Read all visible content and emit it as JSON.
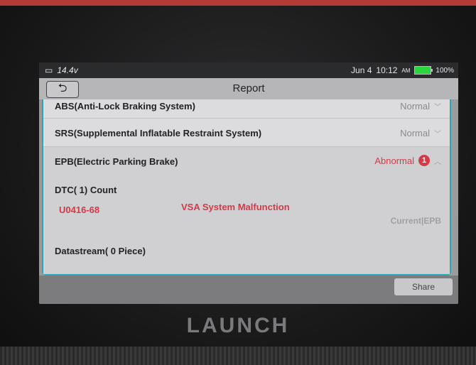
{
  "status_bar": {
    "voltage": "14.4v",
    "date": "Jun 4",
    "time": "10:12",
    "ampm": "AM",
    "battery": "100%"
  },
  "app_bar": {
    "title": "Report",
    "back_icon": "back-arrow-icon"
  },
  "systems": [
    {
      "name": "ABS(Anti-Lock Braking System)",
      "status": "Normal"
    },
    {
      "name": "SRS(Supplemental Inflatable Restraint System)",
      "status": "Normal"
    },
    {
      "name": "EPB(Electric Parking Brake)",
      "status": "Abnormal",
      "badge": "1"
    }
  ],
  "dtc": {
    "heading": "DTC( 1) Count",
    "code": "U0416-68",
    "description": "VSA System Malfunction",
    "ecu": "Current|EPB"
  },
  "datastream": {
    "heading": "Datastream( 0 Piece)"
  },
  "footer": {
    "share_label": "Share"
  },
  "brand": "LAUNCH",
  "colors": {
    "accent": "#2aa6b5",
    "abnormal": "#d23a48",
    "battery": "#2bd53c"
  }
}
